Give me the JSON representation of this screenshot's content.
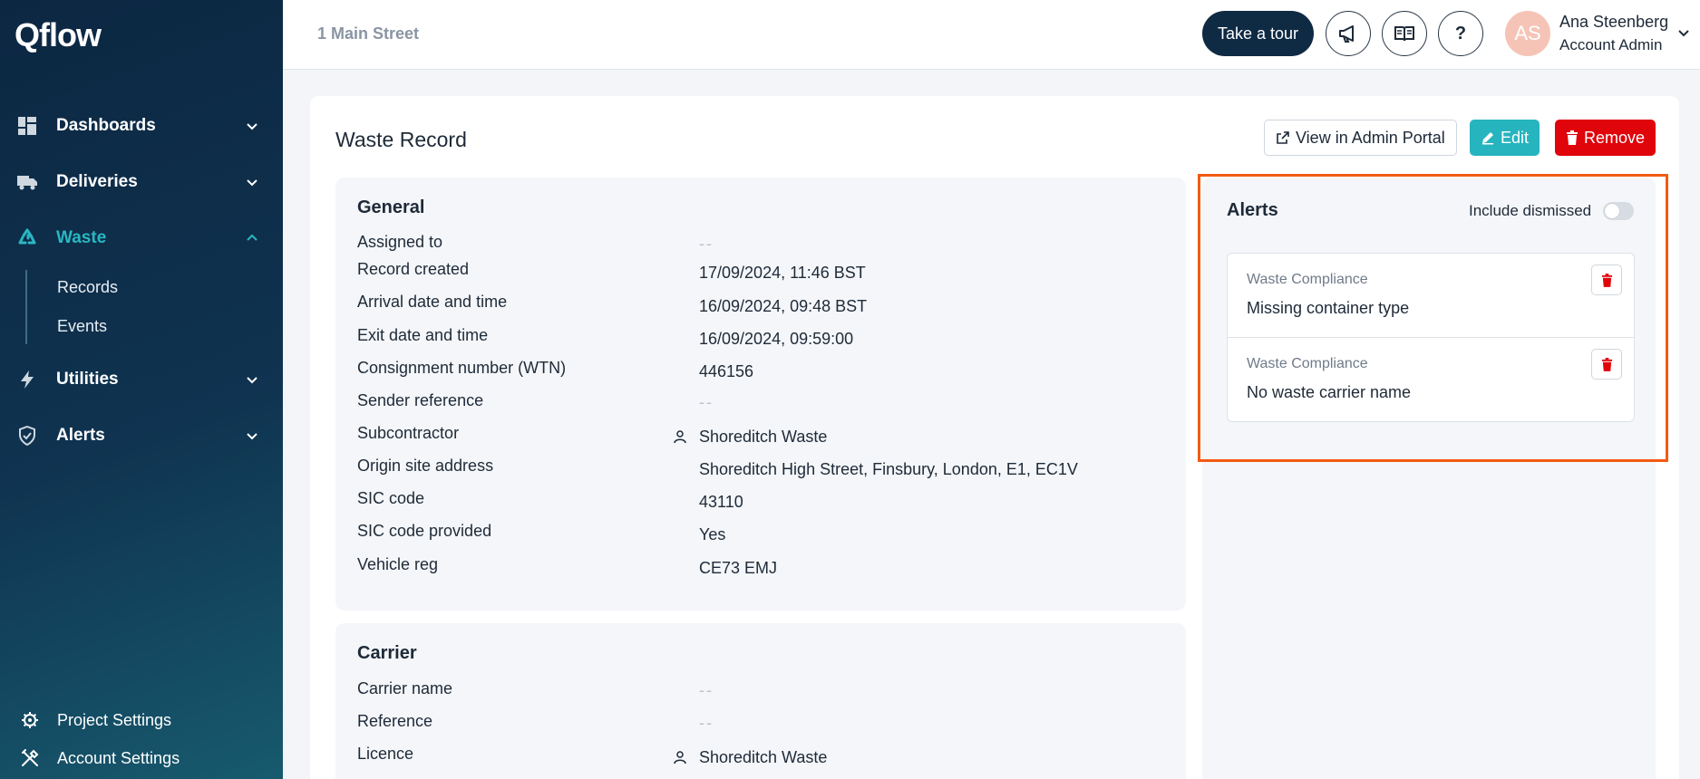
{
  "app": {
    "logo_text": "Qflow"
  },
  "sidebar": {
    "items": [
      {
        "label": "Dashboards",
        "icon": "dashboard-icon"
      },
      {
        "label": "Deliveries",
        "icon": "truck-icon"
      },
      {
        "label": "Waste",
        "icon": "recycle-icon",
        "active": true,
        "children": [
          "Records",
          "Events"
        ]
      },
      {
        "label": "Utilities",
        "icon": "lightning-icon"
      },
      {
        "label": "Alerts",
        "icon": "shield-icon"
      }
    ],
    "bottom": [
      {
        "label": "Project Settings",
        "icon": "gear-icon"
      },
      {
        "label": "Account Settings",
        "icon": "tools-icon"
      }
    ]
  },
  "header": {
    "site_name": "1 Main Street",
    "tour_label": "Take a tour",
    "help_label": "?",
    "user": {
      "initials": "AS",
      "name": "Ana Steenberg",
      "role": "Account Admin"
    }
  },
  "record": {
    "title": "Waste Record",
    "actions": {
      "view_admin": "View in Admin Portal",
      "edit": "Edit",
      "remove": "Remove"
    },
    "general": {
      "title": "General",
      "rows": [
        {
          "label": "Assigned to",
          "value": "--"
        },
        {
          "label": "Record created",
          "value": "17/09/2024, 11:46 BST"
        },
        {
          "label": "Arrival date and time",
          "value": "16/09/2024, 09:48 BST"
        },
        {
          "label": "Exit date and time",
          "value": "16/09/2024, 09:59:00"
        },
        {
          "label": "Consignment number (WTN)",
          "value": "446156"
        },
        {
          "label": "Sender reference",
          "value": "--"
        },
        {
          "label": "Subcontractor",
          "value": "Shoreditch Waste"
        },
        {
          "label": "Origin site address",
          "value": "Shoreditch High Street, Finsbury, London, E1, EC1V"
        },
        {
          "label": "SIC code",
          "value": "43110"
        },
        {
          "label": "SIC code provided",
          "value": "Yes"
        },
        {
          "label": "Vehicle reg",
          "value": "CE73 EMJ"
        }
      ]
    },
    "carrier": {
      "title": "Carrier",
      "rows": [
        {
          "label": "Carrier name",
          "value": "--"
        },
        {
          "label": "Reference",
          "value": "--"
        },
        {
          "label": "Licence",
          "value": "Shoreditch Waste"
        }
      ]
    }
  },
  "alerts": {
    "title": "Alerts",
    "include_dismissed_label": "Include dismissed",
    "include_dismissed": false,
    "items": [
      {
        "category": "Waste Compliance",
        "message": "Missing container type"
      },
      {
        "category": "Waste Compliance",
        "message": "No waste carrier name"
      }
    ]
  },
  "colors": {
    "accent": "#26b4bf",
    "danger": "#e0040b",
    "highlight": "#f45a13",
    "sidebar": "#0c2742"
  }
}
